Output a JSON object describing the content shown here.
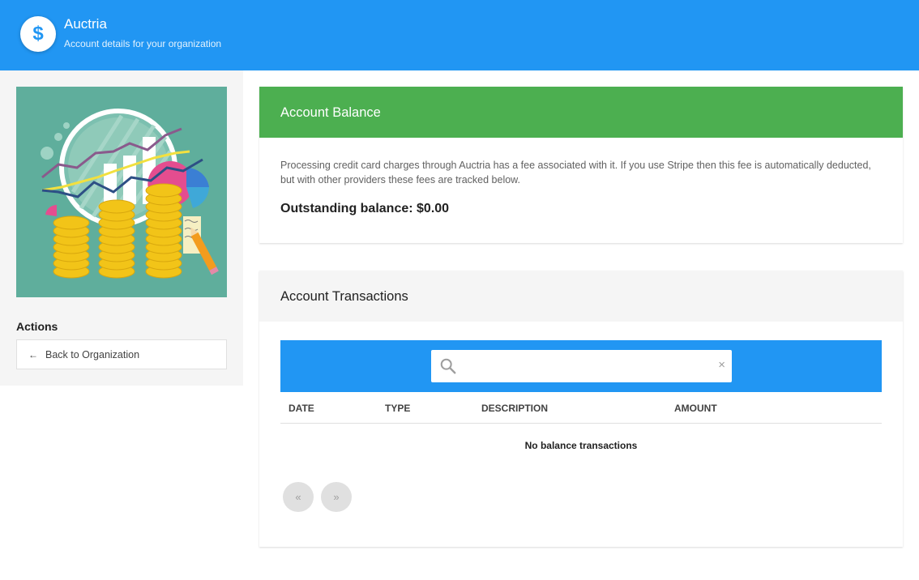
{
  "header": {
    "logo_glyph": "$",
    "title": "Auctria",
    "subtitle": "Account details for your organization",
    "color": "#2196f3"
  },
  "sidebar": {
    "image_icon": "finance-growth-illustration",
    "actions_label": "Actions",
    "back_button_label": "Back to Organization",
    "back_icon": "arrow-left-icon"
  },
  "balance": {
    "title": "Account Balance",
    "description": "Processing credit card charges through Auctria has a fee associated with it. If you use Stripe then this fee is automatically deducted, but with other providers these fees are tracked below.",
    "outstanding": "Outstanding balance: $0.00",
    "color": "#4caf50"
  },
  "transactions": {
    "title": "Account Transactions",
    "search": {
      "value": "",
      "placeholder": "",
      "clear_glyph": "×"
    },
    "columns": [
      "DATE",
      "TYPE",
      "DESCRIPTION",
      "AMOUNT"
    ],
    "empty_message": "No balance transactions",
    "pager": {
      "prev": "«",
      "next": "»"
    }
  }
}
